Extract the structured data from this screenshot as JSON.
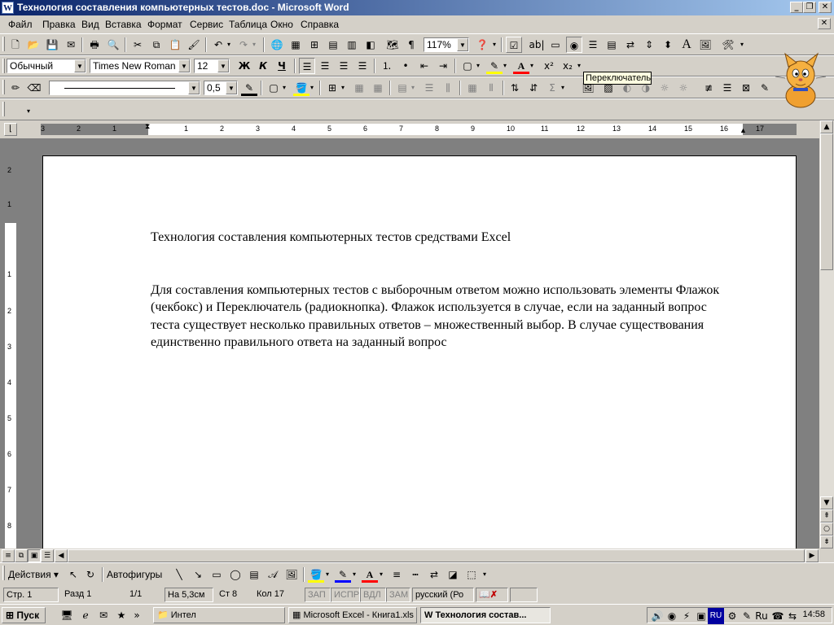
{
  "window": {
    "title": "Технология составления компьютерных тестов.doc - Microsoft Word",
    "app_icon": "W",
    "minimize_glyph": "_",
    "restore_glyph": "❐",
    "close_glyph": "✕"
  },
  "menu": {
    "items": [
      "Файл",
      "Правка",
      "Вид",
      "Вставка",
      "Формат",
      "Сервис",
      "Таблица",
      "Окно",
      "Справка"
    ],
    "close_glyph": "✕"
  },
  "standard_toolbar": {
    "zoom": "117%"
  },
  "formatting_toolbar": {
    "style": "Обычный",
    "font": "Times New Roman",
    "size": "12",
    "bold": "Ж",
    "italic": "К",
    "underline": "Ч"
  },
  "drawing_table_toolbar": {
    "line_weight": "0,5"
  },
  "tooltip": {
    "text": "Переключатель"
  },
  "ruler": {
    "labels": [
      "3",
      "2",
      "1",
      "1",
      "2",
      "3",
      "4",
      "5",
      "6",
      "7",
      "8",
      "9",
      "10",
      "11",
      "12",
      "13",
      "14",
      "15",
      "16",
      "17"
    ],
    "vertical_labels": [
      "2",
      "1",
      "1",
      "1",
      "2",
      "3",
      "4",
      "5",
      "6",
      "7",
      "8"
    ]
  },
  "document": {
    "title": "Технология составления компьютерных тестов средствами Excel",
    "paragraph": "Для составления компьютерных тестов с выборочным ответом можно использовать элементы Флажок (чекбокс) и Переключатель (радиокнопка). Флажок используется в случае, если на заданный вопрос теста существует несколько правильных ответов – множественный выбор. В случае существования единственно правильного ответа на заданный вопрос"
  },
  "drawing_toolbar": {
    "actions": "Действия",
    "autoshapes": "Автофигуры"
  },
  "status_bar": {
    "page": "Стр. 1",
    "section": "Разд 1",
    "pages": "1/1",
    "at": "На 5,3см",
    "line": "Ст 8",
    "col": "Кол 17",
    "rec": "ЗАП",
    "trk": "ИСПР",
    "ext": "ВДЛ",
    "ovr": "ЗАМ",
    "lang": "русский (Ро"
  },
  "taskbar": {
    "start": "Пуск",
    "tasks": [
      {
        "label": "Интел",
        "active": false
      },
      {
        "label": "Microsoft Excel - Книга1.xls",
        "active": false
      },
      {
        "label": "Технология состав...",
        "active": true
      }
    ],
    "tray_lang": "RU",
    "clock": "14:58"
  },
  "colors": {
    "title_active": "#0a246a",
    "title_gradient_end": "#a6caf0",
    "face": "#d4d0c8",
    "workspace": "#808080",
    "tooltip_bg": "#ffffe1",
    "spell_underline": "#ff0000"
  }
}
